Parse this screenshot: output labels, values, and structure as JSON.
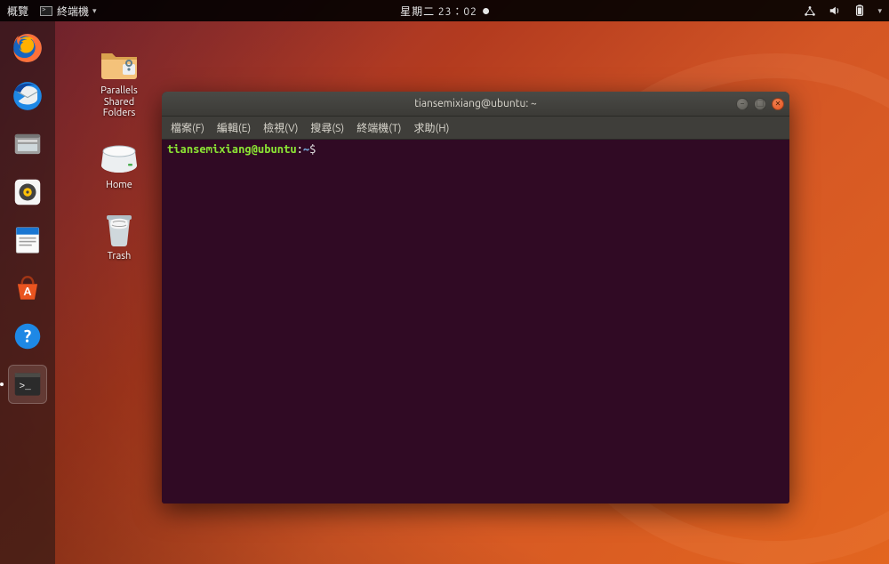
{
  "top_panel": {
    "activities": "概覽",
    "app_name": "終端機",
    "clock": "星期二 23：02",
    "tray": {
      "network_icon": "network-icon",
      "volume_icon": "volume-icon",
      "battery_icon": "battery-icon",
      "power_icon": "power-menu-icon"
    }
  },
  "dock": {
    "items": [
      {
        "name": "firefox-icon"
      },
      {
        "name": "thunderbird-icon"
      },
      {
        "name": "files-icon"
      },
      {
        "name": "rhythmbox-icon"
      },
      {
        "name": "writer-icon"
      },
      {
        "name": "software-icon"
      },
      {
        "name": "help-icon"
      },
      {
        "name": "terminal-icon"
      }
    ]
  },
  "desktop_icons": [
    {
      "label": "Parallels\nShared\nFolders",
      "icon": "folder-lock-icon"
    },
    {
      "label": "Home",
      "icon": "drive-icon"
    },
    {
      "label": "Trash",
      "icon": "trash-icon"
    }
  ],
  "terminal": {
    "title": "tiansemixiang@ubuntu: ~",
    "menu": {
      "file": "檔案(F)",
      "edit": "編輯(E)",
      "view": "檢視(V)",
      "search": "搜尋(S)",
      "terminal": "終端機(T)",
      "help": "求助(H)"
    },
    "prompt": {
      "userhost": "tiansemixiang@ubuntu",
      "colon": ":",
      "path": "~",
      "symbol": "$"
    }
  }
}
